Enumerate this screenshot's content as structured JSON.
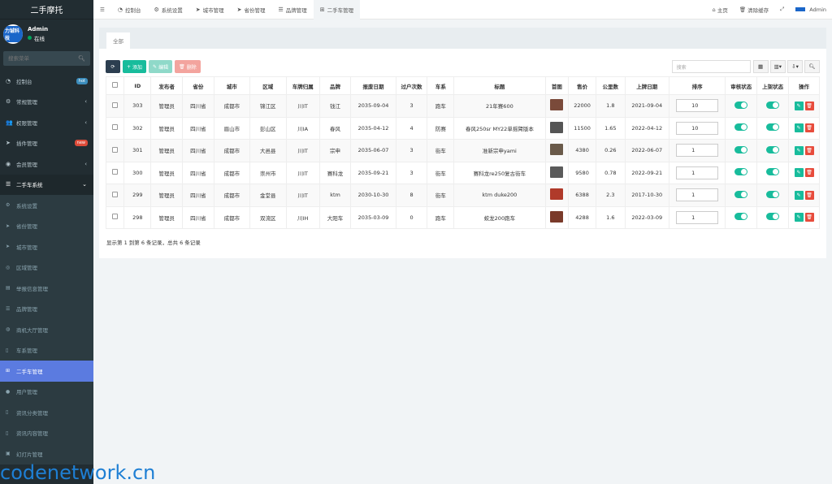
{
  "app": {
    "title": "二手摩托"
  },
  "user": {
    "name": "Admin",
    "status": "在线",
    "avatar_text": "力铖科技"
  },
  "search_menu": {
    "placeholder": "搜索菜单"
  },
  "sidebar": {
    "items": [
      {
        "label": "控制台",
        "icon": "dashboard-icon",
        "badge": "hot",
        "badge_color": "#3c8dbc"
      },
      {
        "label": "常规管理",
        "icon": "cogs-icon",
        "arrow": "‹"
      },
      {
        "label": "权限管理",
        "icon": "group-icon",
        "arrow": "‹"
      },
      {
        "label": "插件管理",
        "icon": "rocket-icon",
        "badge": "new",
        "badge_color": "#dd4b39"
      },
      {
        "label": "会员管理",
        "icon": "user-circle-icon",
        "arrow": "‹"
      },
      {
        "label": "二手车系统",
        "icon": "list-icon",
        "arrow": "⌄"
      }
    ],
    "subitems": [
      {
        "label": "系统设置",
        "icon": "cogs-icon"
      },
      {
        "label": "省份管理",
        "icon": "location-arrow-icon"
      },
      {
        "label": "城市管理",
        "icon": "location-arrow-icon"
      },
      {
        "label": "区域管理",
        "icon": "compass-icon"
      },
      {
        "label": "举报信息管理",
        "icon": "film-icon"
      },
      {
        "label": "品牌管理",
        "icon": "list-icon"
      },
      {
        "label": "商机大厅管理",
        "icon": "globe-icon"
      },
      {
        "label": "车系管理",
        "icon": "file-icon"
      },
      {
        "label": "二手车管理",
        "icon": "sitemap-icon",
        "active": true
      },
      {
        "label": "用户管理",
        "icon": "user-icon"
      },
      {
        "label": "资讯分类管理",
        "icon": "file-icon"
      },
      {
        "label": "资讯内容管理",
        "icon": "file-icon"
      },
      {
        "label": "幻灯片管理",
        "icon": "image-icon"
      }
    ]
  },
  "topbar": {
    "tabs": [
      {
        "label": "控制台",
        "icon": "dashboard-icon"
      },
      {
        "label": "系统设置",
        "icon": "cogs-icon"
      },
      {
        "label": "城市管理",
        "icon": "location-arrow-icon"
      },
      {
        "label": "省份管理",
        "icon": "location-arrow-icon"
      },
      {
        "label": "品牌管理",
        "icon": "list-icon"
      },
      {
        "label": "二手车管理",
        "icon": "sitemap-icon",
        "active": true
      }
    ],
    "home": "主页",
    "clear_cache": "清除缓存",
    "user": "Admin"
  },
  "panel": {
    "tab": "全部",
    "buttons": {
      "add": "添加",
      "edit": "编辑",
      "delete": "删除"
    },
    "search_placeholder": "搜索",
    "columns": [
      "",
      "ID",
      "发布者",
      "省份",
      "城市",
      "区域",
      "车牌归属",
      "品牌",
      "报废日期",
      "过户次数",
      "车系",
      "标题",
      "首图",
      "售价",
      "公里数",
      "上牌日期",
      "排序",
      "审核状态",
      "上架状态",
      "操作"
    ],
    "rows": [
      {
        "id": "303",
        "publisher": "管理员",
        "province": "四川省",
        "city": "成都市",
        "district": "锦江区",
        "plate": "川IT",
        "brand": "钱江",
        "scrap_date": "2035-09-04",
        "transfers": "3",
        "series": "跑车",
        "title": "21年赛600",
        "thumb_color": "#7a4a3a",
        "price": "22000",
        "km": "1.8",
        "reg_date": "2021-09-04",
        "sort": "10"
      },
      {
        "id": "302",
        "publisher": "管理员",
        "province": "四川省",
        "city": "眉山市",
        "district": "彭山区",
        "plate": "川IA",
        "brand": "春风",
        "scrap_date": "2035-04-12",
        "transfers": "4",
        "series": "防赛",
        "title": "春风250sr MY22单摇臂版本",
        "thumb_color": "#555555",
        "price": "11500",
        "km": "1.65",
        "reg_date": "2022-04-12",
        "sort": "10"
      },
      {
        "id": "301",
        "publisher": "管理员",
        "province": "四川省",
        "city": "成都市",
        "district": "大邑县",
        "plate": "川IT",
        "brand": "宗申",
        "scrap_date": "2035-06-07",
        "transfers": "3",
        "series": "街车",
        "title": "准新宗申yami",
        "thumb_color": "#6a5a4a",
        "price": "4380",
        "km": "0.26",
        "reg_date": "2022-06-07",
        "sort": "1"
      },
      {
        "id": "300",
        "publisher": "管理员",
        "province": "四川省",
        "city": "成都市",
        "district": "崇州市",
        "plate": "川IT",
        "brand": "赛科龙",
        "scrap_date": "2035-09-21",
        "transfers": "3",
        "series": "街车",
        "title": "赛科龙re250复古街车",
        "thumb_color": "#5a5a5a",
        "price": "9580",
        "km": "0.78",
        "reg_date": "2022-09-21",
        "sort": "1"
      },
      {
        "id": "299",
        "publisher": "管理员",
        "province": "四川省",
        "city": "成都市",
        "district": "金堂县",
        "plate": "川IT",
        "brand": "ktm",
        "scrap_date": "2030-10-30",
        "transfers": "8",
        "series": "街车",
        "title": "ktm duke200",
        "thumb_color": "#b03a2a",
        "price": "6388",
        "km": "2.3",
        "reg_date": "2017-10-30",
        "sort": "1"
      },
      {
        "id": "298",
        "publisher": "管理员",
        "province": "四川省",
        "city": "成都市",
        "district": "双流区",
        "plate": "川IH",
        "brand": "大阳车",
        "scrap_date": "2035-03-09",
        "transfers": "0",
        "series": "跑车",
        "title": "蛟龙200跑车",
        "thumb_color": "#7a3a2a",
        "price": "4288",
        "km": "1.6",
        "reg_date": "2022-03-09",
        "sort": "1"
      }
    ],
    "summary": "显示第 1 到第 6 条记录，总共 6 条记录"
  },
  "watermark": "codenetwork.cn"
}
